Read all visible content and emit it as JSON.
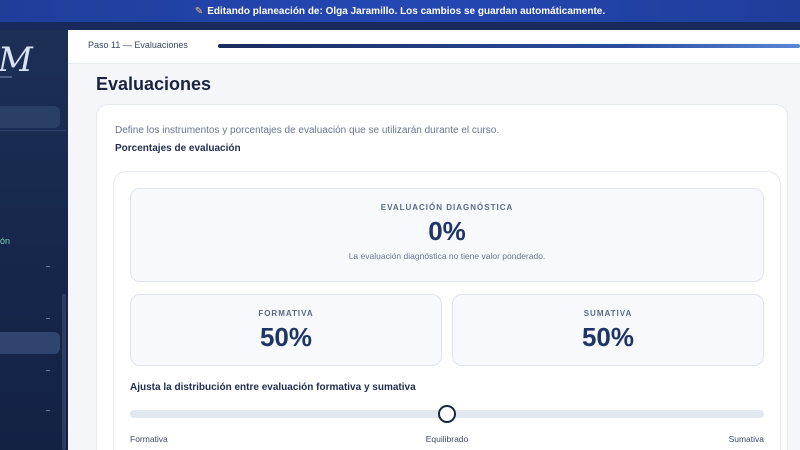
{
  "banner": {
    "icon": "pencil-icon",
    "text": "Editando planeación de: Olga Jaramillo. Los cambios se guardan automáticamente."
  },
  "sidebar": {
    "logo": "M",
    "partial_label": "ón"
  },
  "step": {
    "label": "Paso 11 — Evaluaciones",
    "progress_percent": 100
  },
  "page": {
    "title": "Evaluaciones",
    "description": "Define los instrumentos y porcentajes de evaluación que se utilizarán durante el curso.",
    "section_title": "Porcentajes de evaluación"
  },
  "diagnostic": {
    "label": "EVALUACIÓN DIAGNÓSTICA",
    "value": "0%",
    "note": "La evaluación diagnóstica no tiene valor ponderado."
  },
  "formative": {
    "label": "FORMATIVA",
    "value": "50%"
  },
  "summative": {
    "label": "SUMATIVA",
    "value": "50%"
  },
  "slider": {
    "title": "Ajusta la distribución entre evaluación formativa y sumativa",
    "value_percent": 50,
    "left_label": "Formativa",
    "mid_label": "Equilibrado",
    "right_label": "Sumativa"
  },
  "colors": {
    "accent": "#1f3566",
    "banner": "#2447b3",
    "sidebar": "#1c2f55"
  }
}
